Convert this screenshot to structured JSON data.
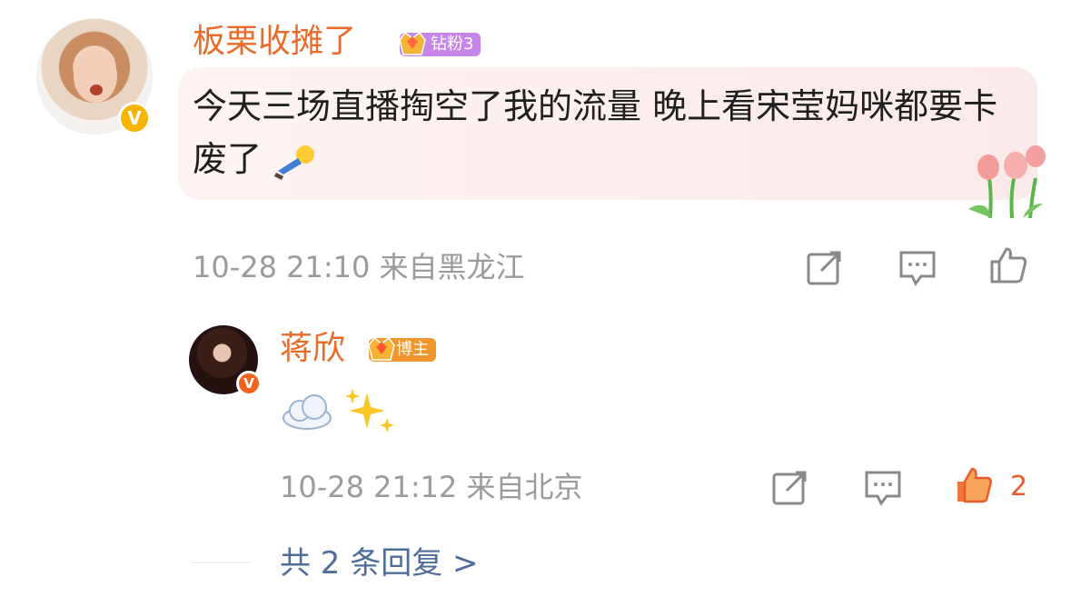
{
  "comment": {
    "author": "板栗收摊了",
    "fan_badge": "钻粉3",
    "fan_badge_color": "#c586e8",
    "text": "今天三场直播掏空了我的流量 晚上看宋莹妈咪都要卡废了",
    "inline_emoji": "lying-down-emoji",
    "decoration": "tulips-decoration",
    "timestamp": "10-28 21:10",
    "location": "来自黑龙江",
    "verified_icon": "verified-v-icon"
  },
  "reply": {
    "author": "蒋欣",
    "badge": "博主",
    "badge_color": "#f0962e",
    "emoji": [
      "cloud-emoji",
      "sparkles-emoji"
    ],
    "timestamp": "10-28 21:12",
    "location": "来自北京",
    "like_count": "2",
    "liked": true,
    "like_color": "#f0753c"
  },
  "footer": {
    "more_replies": "共 2 条回复 >"
  },
  "colors": {
    "name": "#e86b2a",
    "meta": "#9b9b9b",
    "link": "#4e6e99",
    "bubble": "#fbeeed"
  }
}
